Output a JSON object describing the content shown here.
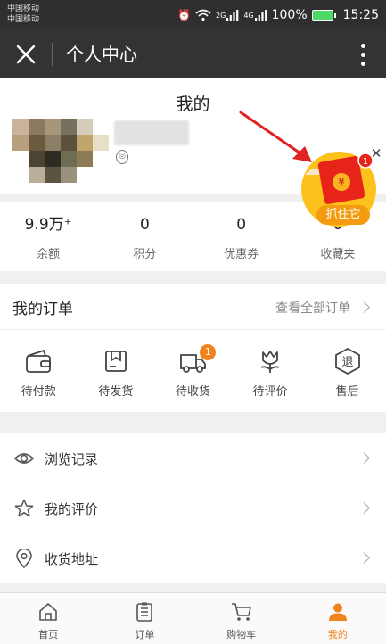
{
  "status_bar": {
    "carrier_1": "中国移动",
    "carrier_2": "中国移动",
    "network_1": "2G",
    "network_2": "4G",
    "battery": "100%",
    "time": "15:25"
  },
  "title_bar": {
    "title": "个人中心"
  },
  "profile": {
    "heading": "我的"
  },
  "red_packet": {
    "label": "抓住它",
    "badge": "1",
    "symbol": "¥"
  },
  "stats": [
    {
      "value": "9.9万⁺",
      "label": "余额"
    },
    {
      "value": "0",
      "label": "积分"
    },
    {
      "value": "0",
      "label": "优惠券"
    },
    {
      "value": "0",
      "label": "收藏夹"
    }
  ],
  "orders": {
    "title": "我的订单",
    "view_all": "查看全部订单",
    "statuses": [
      {
        "label": "待付款",
        "icon": "wallet-icon"
      },
      {
        "label": "待发货",
        "icon": "package-icon"
      },
      {
        "label": "待收货",
        "icon": "truck-icon",
        "badge": "1"
      },
      {
        "label": "待评价",
        "icon": "flower-icon"
      },
      {
        "label": "售后",
        "icon": "refund-icon",
        "glyph": "退"
      }
    ]
  },
  "menu": [
    {
      "label": "浏览记录",
      "icon": "eye-icon"
    },
    {
      "label": "我的评价",
      "icon": "star-icon"
    },
    {
      "label": "收货地址",
      "icon": "location-icon"
    }
  ],
  "tabbar": [
    {
      "label": "首页",
      "icon": "home-icon"
    },
    {
      "label": "订单",
      "icon": "order-list-icon"
    },
    {
      "label": "购物车",
      "icon": "cart-icon"
    },
    {
      "label": "我的",
      "icon": "user-icon",
      "active": true
    }
  ],
  "colors": {
    "accent": "#f0831e",
    "header_bg": "#333333",
    "status_bg": "#2f2f2f",
    "red_packet": "#e8231a",
    "red_packet_glow": "#fcc21b"
  }
}
